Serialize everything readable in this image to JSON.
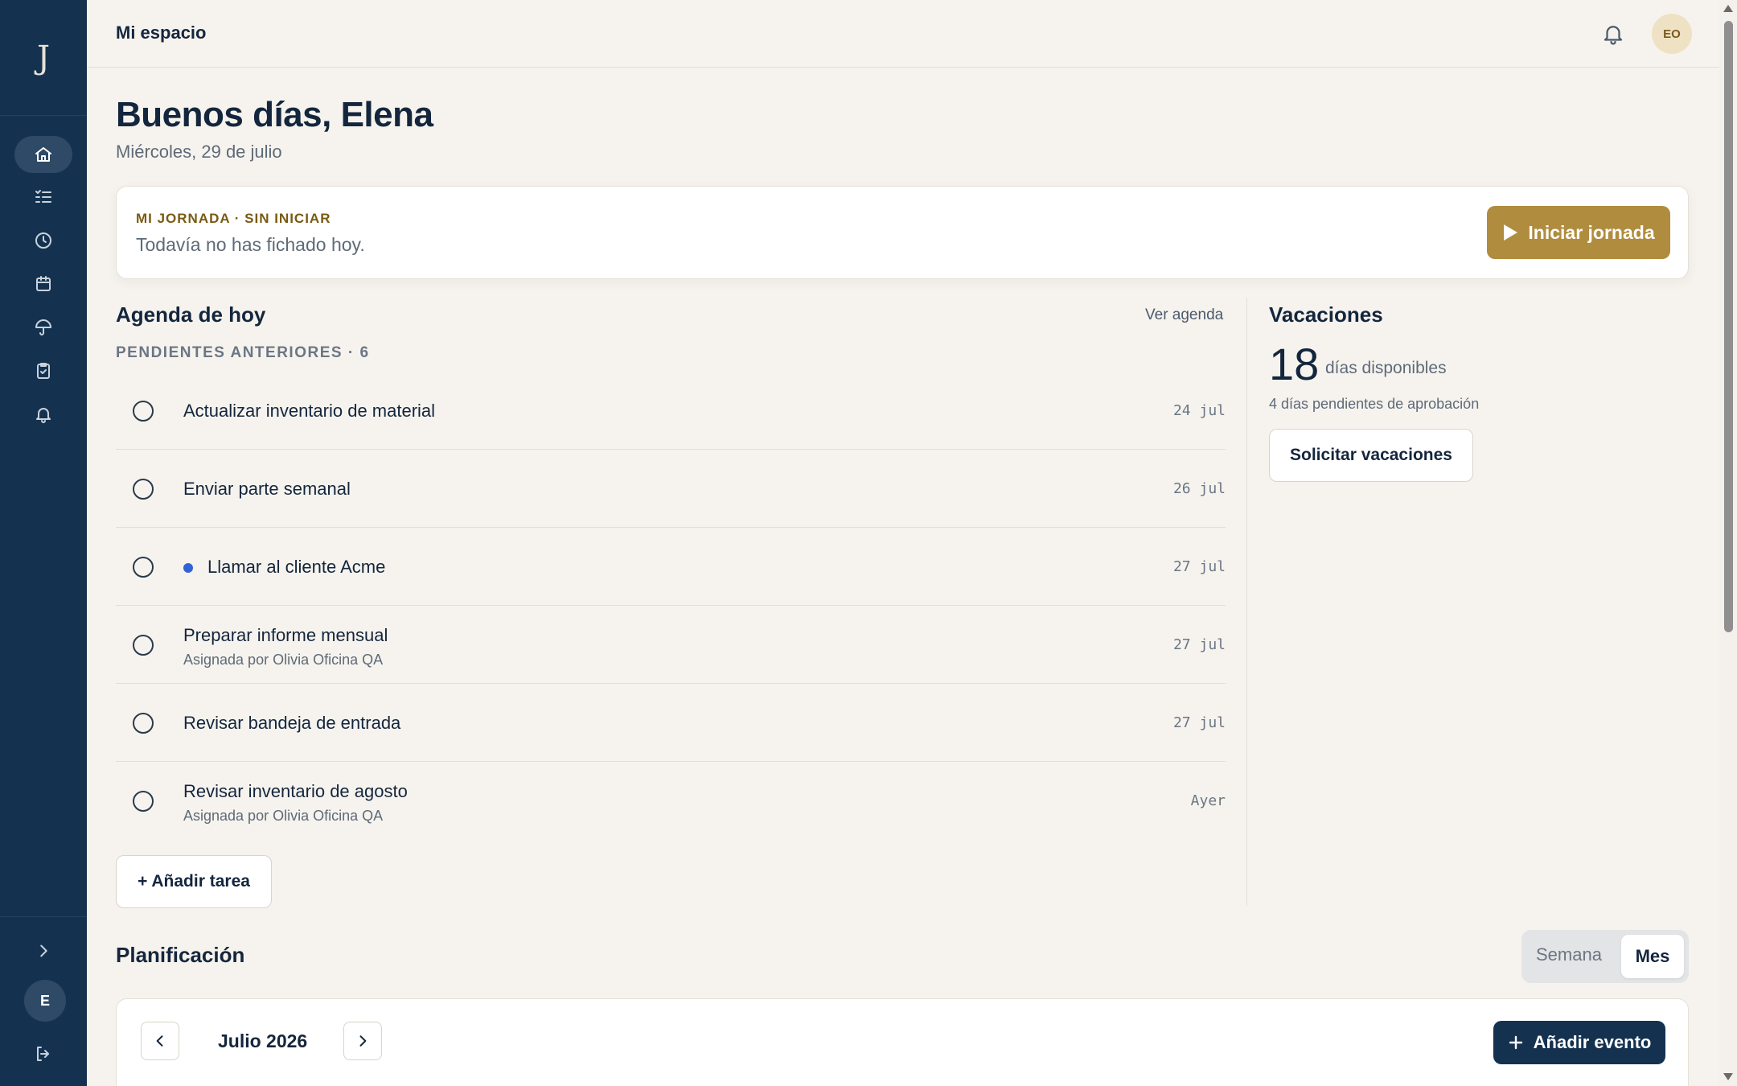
{
  "sidebar": {
    "logo": "J",
    "nav": [
      {
        "icon": "home-icon"
      },
      {
        "icon": "tasks-icon"
      },
      {
        "icon": "clock-icon"
      },
      {
        "icon": "calendar-icon"
      },
      {
        "icon": "umbrella-icon"
      },
      {
        "icon": "clipboard-icon"
      },
      {
        "icon": "bell-icon"
      }
    ],
    "user_initial": "E"
  },
  "header": {
    "breadcrumb": "Mi espacio",
    "avatar_initials": "EO"
  },
  "greeting": {
    "title": "Buenos días, Elena",
    "date": "Miércoles, 29 de julio"
  },
  "jornada": {
    "tag": "MI JORNADA · SIN INICIAR",
    "text": "Todavía no has fichado hoy.",
    "button": "Iniciar jornada"
  },
  "agenda": {
    "title": "Agenda de hoy",
    "link": "Ver agenda",
    "pending_label": "PENDIENTES ANTERIORES · 6",
    "tasks": [
      {
        "title": "Actualizar inventario de material",
        "subtitle": "",
        "date": "24 jul"
      },
      {
        "title": "Enviar parte semanal",
        "subtitle": "",
        "date": "26 jul"
      },
      {
        "title": "Llamar al cliente Acme",
        "subtitle": "",
        "date": "27 jul"
      },
      {
        "title": "Preparar informe mensual",
        "subtitle": "Asignada por Olivia Oficina QA",
        "date": "27 jul"
      },
      {
        "title": "Revisar bandeja de entrada",
        "subtitle": "",
        "date": "27 jul"
      },
      {
        "title": "Revisar inventario de agosto",
        "subtitle": "Asignada por Olivia Oficina QA",
        "date": "Ayer"
      }
    ],
    "add_button": "+ Añadir tarea"
  },
  "vacaciones": {
    "title": "Vacaciones",
    "days": "18",
    "available_label": "días disponibles",
    "pending": "4 días pendientes de aprobación",
    "button": "Solicitar vacaciones"
  },
  "planificacion": {
    "title": "Planificación",
    "toggle_semana": "Semana",
    "toggle_mes": "Mes",
    "month": "Julio 2026",
    "add_event": "Añadir evento"
  },
  "colors": {
    "sidebar": "#143250",
    "accent_gold": "#b08c3e",
    "dot_blue": "#2f63d6"
  }
}
